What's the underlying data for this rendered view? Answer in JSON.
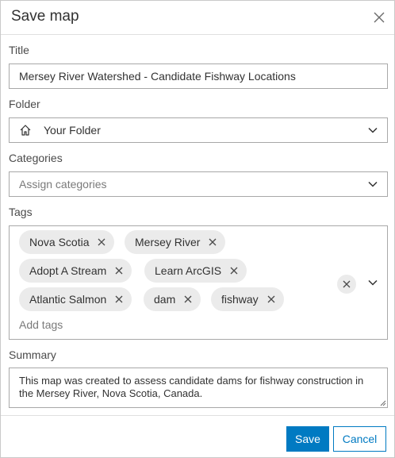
{
  "dialog": {
    "title": "Save map",
    "close_icon": "close-icon"
  },
  "fields": {
    "title": {
      "label": "Title",
      "value": "Mersey River Watershed - Candidate Fishway Locations"
    },
    "folder": {
      "label": "Folder",
      "icon": "home-icon",
      "value": "Your Folder"
    },
    "categories": {
      "label": "Categories",
      "placeholder": "Assign categories"
    },
    "tags": {
      "label": "Tags",
      "items": [
        "Nova Scotia",
        "Mersey River",
        "Adopt A Stream",
        "Learn ArcGIS",
        "Atlantic Salmon",
        "dam",
        "fishway"
      ],
      "placeholder": "Add tags"
    },
    "summary": {
      "label": "Summary",
      "value": "This map was created to assess candidate dams for fishway construction in the Mersey River, Nova Scotia, Canada."
    }
  },
  "buttons": {
    "save": "Save",
    "cancel": "Cancel"
  },
  "colors": {
    "accent": "#007ac2",
    "chip_bg": "#ebebeb",
    "border": "#a8a8a8"
  }
}
